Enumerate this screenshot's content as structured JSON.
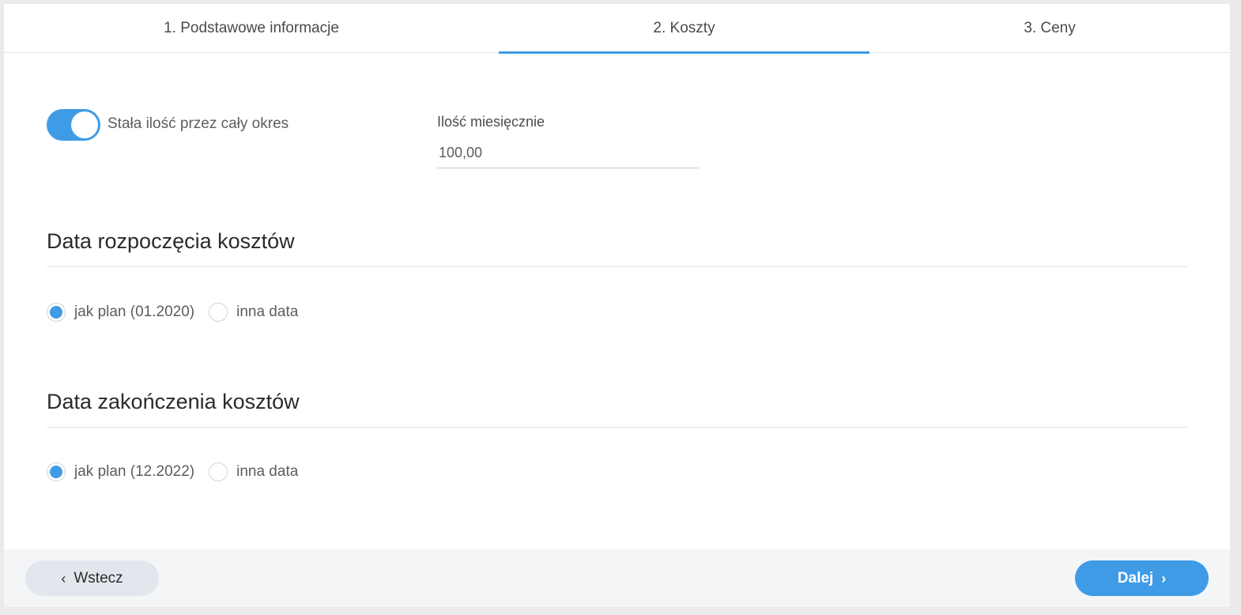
{
  "tabs": [
    {
      "label": "1. Podstawowe informacje",
      "active": false
    },
    {
      "label": "2. Koszty",
      "active": true
    },
    {
      "label": "3. Ceny",
      "active": false
    }
  ],
  "toggle": {
    "label": "Stała ilość przez cały okres",
    "on": true
  },
  "quantity": {
    "label": "Ilość miesięcznie",
    "value": "100,00"
  },
  "start_section": {
    "title": "Data rozpoczęcia kosztów",
    "options": [
      {
        "label": "jak plan (01.2020)",
        "checked": true
      },
      {
        "label": "inna data",
        "checked": false
      }
    ]
  },
  "end_section": {
    "title": "Data zakończenia kosztów",
    "options": [
      {
        "label": "jak plan (12.2022)",
        "checked": true
      },
      {
        "label": "inna data",
        "checked": false
      }
    ]
  },
  "footer": {
    "back_label": "Wstecz",
    "next_label": "Dalej",
    "back_icon": "chevron-left-icon",
    "next_icon": "chevron-right-icon"
  },
  "colors": {
    "accent": "#3f9be6",
    "footer_bg": "#f4f5f7",
    "back_button_bg": "#e3e6ed"
  }
}
